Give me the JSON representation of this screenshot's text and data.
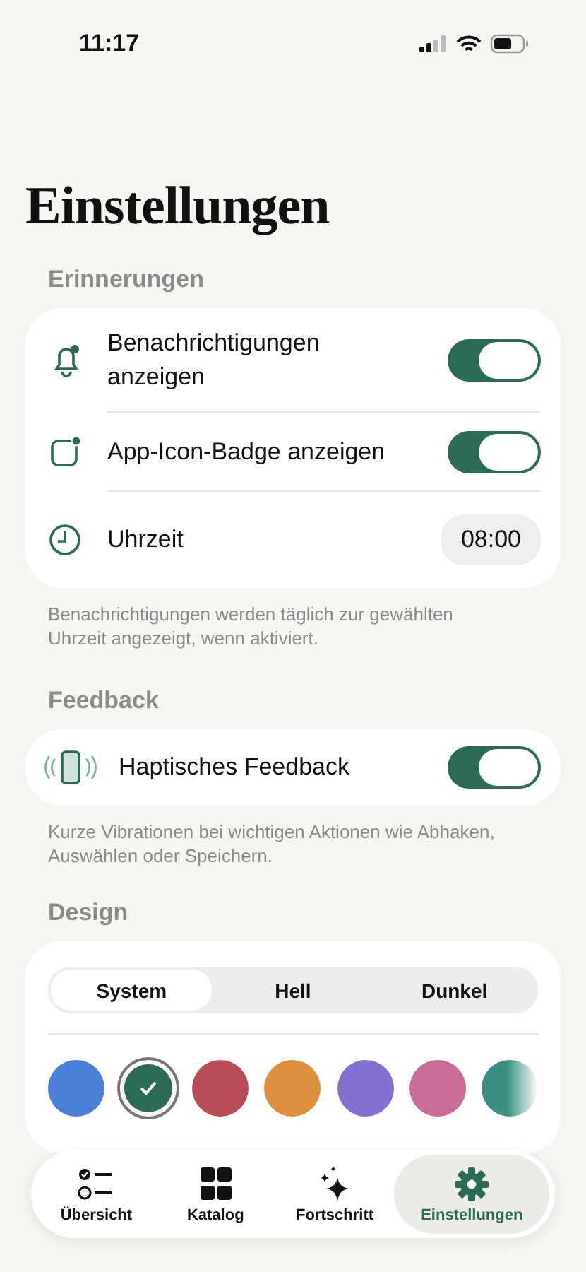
{
  "status_bar": {
    "time": "11:17"
  },
  "title": "Einstellungen",
  "sections": [
    {
      "header": "Erinnerungen",
      "footer": "Benachrichtigungen werden täglich zur gewählten Uhrzeit angezeigt, wenn aktiviert.",
      "rows": [
        {
          "kind": "toggle",
          "label": "Benachrichtigungen anzeigen",
          "on": true
        },
        {
          "kind": "toggle",
          "label": "App-Icon-Badge anzeigen",
          "on": true
        },
        {
          "kind": "time",
          "label": "Uhrzeit",
          "value": "08:00"
        }
      ]
    },
    {
      "header": "Feedback",
      "footer": "Kurze Vibrationen bei wichtigen Aktionen wie Abhaken, Auswählen oder Speichern.",
      "rows": [
        {
          "kind": "toggle",
          "label": "Haptisches Feedback",
          "on": true
        }
      ]
    }
  ],
  "design": {
    "header": "Design",
    "segments": [
      {
        "label": "System",
        "selected": true
      },
      {
        "label": "Hell",
        "selected": false
      },
      {
        "label": "Dunkel",
        "selected": false
      }
    ],
    "colors": [
      {
        "color": "#4a7fd9",
        "selected": false
      },
      {
        "color": "#2b6b53",
        "selected": true
      },
      {
        "color": "#b94c58",
        "selected": false
      },
      {
        "color": "#dd8f3d",
        "selected": false
      },
      {
        "color": "#8370cf",
        "selected": false
      },
      {
        "color": "#c96b98",
        "selected": false
      },
      {
        "color": "#3a8f85",
        "selected": false
      }
    ]
  },
  "tab_bar": [
    {
      "label": "Übersicht",
      "selected": false
    },
    {
      "label": "Katalog",
      "selected": false
    },
    {
      "label": "Fortschritt",
      "selected": false
    },
    {
      "label": "Einstellungen",
      "selected": true
    }
  ]
}
